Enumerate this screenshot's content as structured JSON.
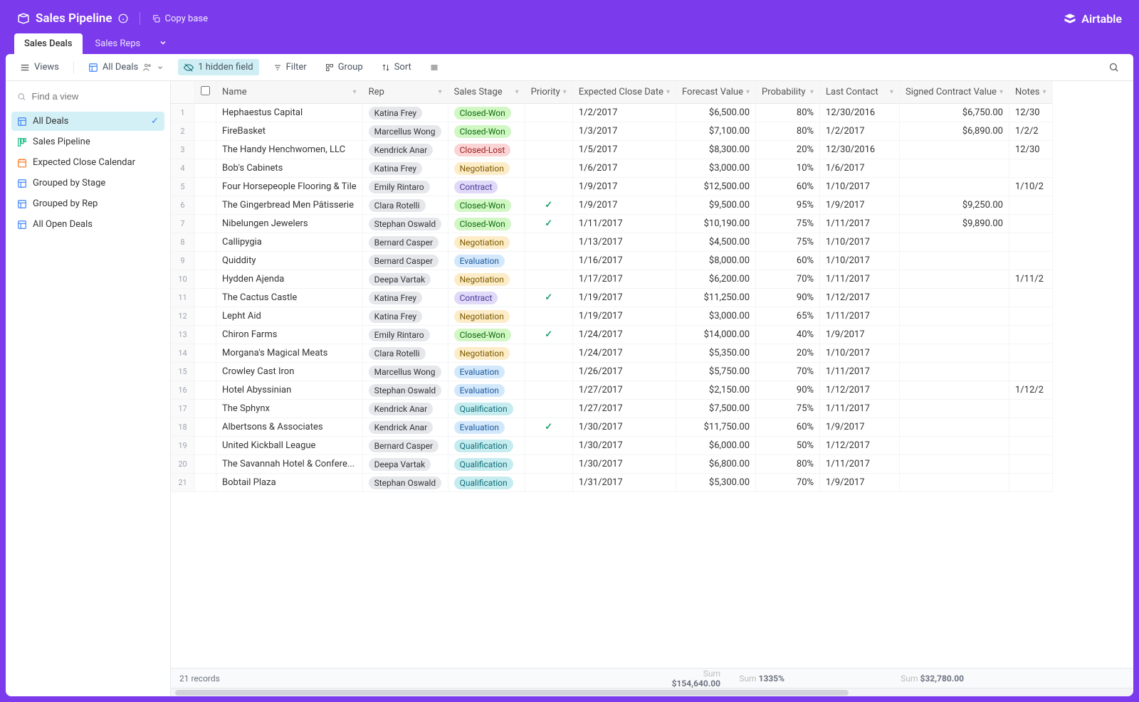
{
  "header": {
    "base_title": "Sales Pipeline",
    "copy_base": "Copy base",
    "brand": "Airtable"
  },
  "tabs": [
    {
      "label": "Sales Deals",
      "active": true
    },
    {
      "label": "Sales Reps",
      "active": false
    }
  ],
  "toolbar": {
    "views": "Views",
    "view_name": "All Deals",
    "hidden_field": "1 hidden field",
    "filter": "Filter",
    "group": "Group",
    "sort": "Sort"
  },
  "sidebar": {
    "search_placeholder": "Find a view",
    "views": [
      {
        "label": "All Deals",
        "icon": "grid",
        "color": "#3b82f6",
        "selected": true
      },
      {
        "label": "Sales Pipeline",
        "icon": "kanban",
        "color": "#10b981",
        "selected": false
      },
      {
        "label": "Expected Close Calendar",
        "icon": "calendar",
        "color": "#f97316",
        "selected": false
      },
      {
        "label": "Grouped by Stage",
        "icon": "grid",
        "color": "#3b82f6",
        "selected": false
      },
      {
        "label": "Grouped by Rep",
        "icon": "grid",
        "color": "#3b82f6",
        "selected": false
      },
      {
        "label": "All Open Deals",
        "icon": "grid",
        "color": "#3b82f6",
        "selected": false
      }
    ]
  },
  "columns": [
    "Name",
    "Rep",
    "Sales Stage",
    "Priority",
    "Expected Close Date",
    "Forecast Value",
    "Probability",
    "Last Contact",
    "Signed Contract Value",
    "Notes"
  ],
  "rows": [
    {
      "n": 1,
      "name": "Hephaestus Capital",
      "rep": "Katina Frey",
      "stage": "Closed-Won",
      "priority": false,
      "close": "1/2/2017",
      "forecast": "$6,500.00",
      "prob": "80%",
      "contact": "12/30/2016",
      "signed": "$6,750.00",
      "notes": "12/30"
    },
    {
      "n": 2,
      "name": "FireBasket",
      "rep": "Marcellus Wong",
      "stage": "Closed-Won",
      "priority": false,
      "close": "1/3/2017",
      "forecast": "$7,100.00",
      "prob": "80%",
      "contact": "1/2/2017",
      "signed": "$6,890.00",
      "notes": "1/2/2"
    },
    {
      "n": 3,
      "name": "The Handy Henchwomen, LLC",
      "rep": "Kendrick Anar",
      "stage": "Closed-Lost",
      "priority": false,
      "close": "1/5/2017",
      "forecast": "$8,300.00",
      "prob": "20%",
      "contact": "12/30/2016",
      "signed": "",
      "notes": "12/30"
    },
    {
      "n": 4,
      "name": "Bob's Cabinets",
      "rep": "Katina Frey",
      "stage": "Negotiation",
      "priority": false,
      "close": "1/6/2017",
      "forecast": "$3,000.00",
      "prob": "10%",
      "contact": "1/6/2017",
      "signed": "",
      "notes": ""
    },
    {
      "n": 5,
      "name": "Four Horsepeople Flooring & Tile",
      "rep": "Emily Rintaro",
      "stage": "Contract",
      "priority": false,
      "close": "1/9/2017",
      "forecast": "$12,500.00",
      "prob": "60%",
      "contact": "1/10/2017",
      "signed": "",
      "notes": "1/10/2"
    },
    {
      "n": 6,
      "name": "The Gingerbread Men Pâtisserie",
      "rep": "Clara Rotelli",
      "stage": "Closed-Won",
      "priority": true,
      "close": "1/9/2017",
      "forecast": "$9,500.00",
      "prob": "95%",
      "contact": "1/9/2017",
      "signed": "$9,250.00",
      "notes": ""
    },
    {
      "n": 7,
      "name": "Nibelungen Jewelers",
      "rep": "Stephan Oswald",
      "stage": "Closed-Won",
      "priority": true,
      "close": "1/11/2017",
      "forecast": "$10,190.00",
      "prob": "75%",
      "contact": "1/11/2017",
      "signed": "$9,890.00",
      "notes": ""
    },
    {
      "n": 8,
      "name": "Callipygia",
      "rep": "Bernard Casper",
      "stage": "Negotiation",
      "priority": false,
      "close": "1/13/2017",
      "forecast": "$4,500.00",
      "prob": "75%",
      "contact": "1/10/2017",
      "signed": "",
      "notes": ""
    },
    {
      "n": 9,
      "name": "Quiddity",
      "rep": "Bernard Casper",
      "stage": "Evaluation",
      "priority": false,
      "close": "1/16/2017",
      "forecast": "$8,000.00",
      "prob": "60%",
      "contact": "1/10/2017",
      "signed": "",
      "notes": ""
    },
    {
      "n": 10,
      "name": "Hydden Ajenda",
      "rep": "Deepa Vartak",
      "stage": "Negotiation",
      "priority": false,
      "close": "1/17/2017",
      "forecast": "$6,200.00",
      "prob": "70%",
      "contact": "1/11/2017",
      "signed": "",
      "notes": "1/11/2"
    },
    {
      "n": 11,
      "name": "The Cactus Castle",
      "rep": "Katina Frey",
      "stage": "Contract",
      "priority": true,
      "close": "1/19/2017",
      "forecast": "$11,250.00",
      "prob": "90%",
      "contact": "1/12/2017",
      "signed": "",
      "notes": ""
    },
    {
      "n": 12,
      "name": "Lepht Aid",
      "rep": "Katina Frey",
      "stage": "Negotiation",
      "priority": false,
      "close": "1/19/2017",
      "forecast": "$3,000.00",
      "prob": "65%",
      "contact": "1/11/2017",
      "signed": "",
      "notes": ""
    },
    {
      "n": 13,
      "name": "Chiron Farms",
      "rep": "Emily Rintaro",
      "stage": "Closed-Won",
      "priority": true,
      "close": "1/24/2017",
      "forecast": "$14,000.00",
      "prob": "40%",
      "contact": "1/9/2017",
      "signed": "",
      "notes": ""
    },
    {
      "n": 14,
      "name": "Morgana's Magical Meats",
      "rep": "Clara Rotelli",
      "stage": "Negotiation",
      "priority": false,
      "close": "1/24/2017",
      "forecast": "$5,350.00",
      "prob": "20%",
      "contact": "1/10/2017",
      "signed": "",
      "notes": ""
    },
    {
      "n": 15,
      "name": "Crowley Cast Iron",
      "rep": "Marcellus Wong",
      "stage": "Evaluation",
      "priority": false,
      "close": "1/26/2017",
      "forecast": "$5,750.00",
      "prob": "70%",
      "contact": "1/11/2017",
      "signed": "",
      "notes": ""
    },
    {
      "n": 16,
      "name": "Hotel Abyssinian",
      "rep": "Stephan Oswald",
      "stage": "Evaluation",
      "priority": false,
      "close": "1/27/2017",
      "forecast": "$2,150.00",
      "prob": "90%",
      "contact": "1/12/2017",
      "signed": "",
      "notes": "1/12/2"
    },
    {
      "n": 17,
      "name": "The Sphynx",
      "rep": "Kendrick Anar",
      "stage": "Qualification",
      "priority": false,
      "close": "1/27/2017",
      "forecast": "$7,500.00",
      "prob": "75%",
      "contact": "1/11/2017",
      "signed": "",
      "notes": ""
    },
    {
      "n": 18,
      "name": "Albertsons & Associates",
      "rep": "Kendrick Anar",
      "stage": "Evaluation",
      "priority": true,
      "close": "1/30/2017",
      "forecast": "$11,750.00",
      "prob": "60%",
      "contact": "1/9/2017",
      "signed": "",
      "notes": ""
    },
    {
      "n": 19,
      "name": "United Kickball League",
      "rep": "Bernard Casper",
      "stage": "Qualification",
      "priority": false,
      "close": "1/30/2017",
      "forecast": "$6,000.00",
      "prob": "50%",
      "contact": "1/12/2017",
      "signed": "",
      "notes": ""
    },
    {
      "n": 20,
      "name": "The Savannah Hotel & Confere...",
      "rep": "Deepa Vartak",
      "stage": "Qualification",
      "priority": false,
      "close": "1/30/2017",
      "forecast": "$6,800.00",
      "prob": "80%",
      "contact": "1/11/2017",
      "signed": "",
      "notes": ""
    },
    {
      "n": 21,
      "name": "Bobtail Plaza",
      "rep": "Stephan Oswald",
      "stage": "Qualification",
      "priority": false,
      "close": "1/31/2017",
      "forecast": "$5,300.00",
      "prob": "70%",
      "contact": "1/9/2017",
      "signed": "",
      "notes": ""
    }
  ],
  "summary": {
    "records": "21 records",
    "forecast_label": "Sum",
    "forecast_sum": "$154,640.00",
    "prob_label": "Sum",
    "prob_sum": "1335%",
    "signed_label": "Sum",
    "signed_sum": "$32,780.00"
  },
  "stage_class": {
    "Closed-Won": "stage-won",
    "Closed-Lost": "stage-lost",
    "Negotiation": "stage-neg",
    "Contract": "stage-contract",
    "Evaluation": "stage-eval",
    "Qualification": "stage-qual"
  }
}
